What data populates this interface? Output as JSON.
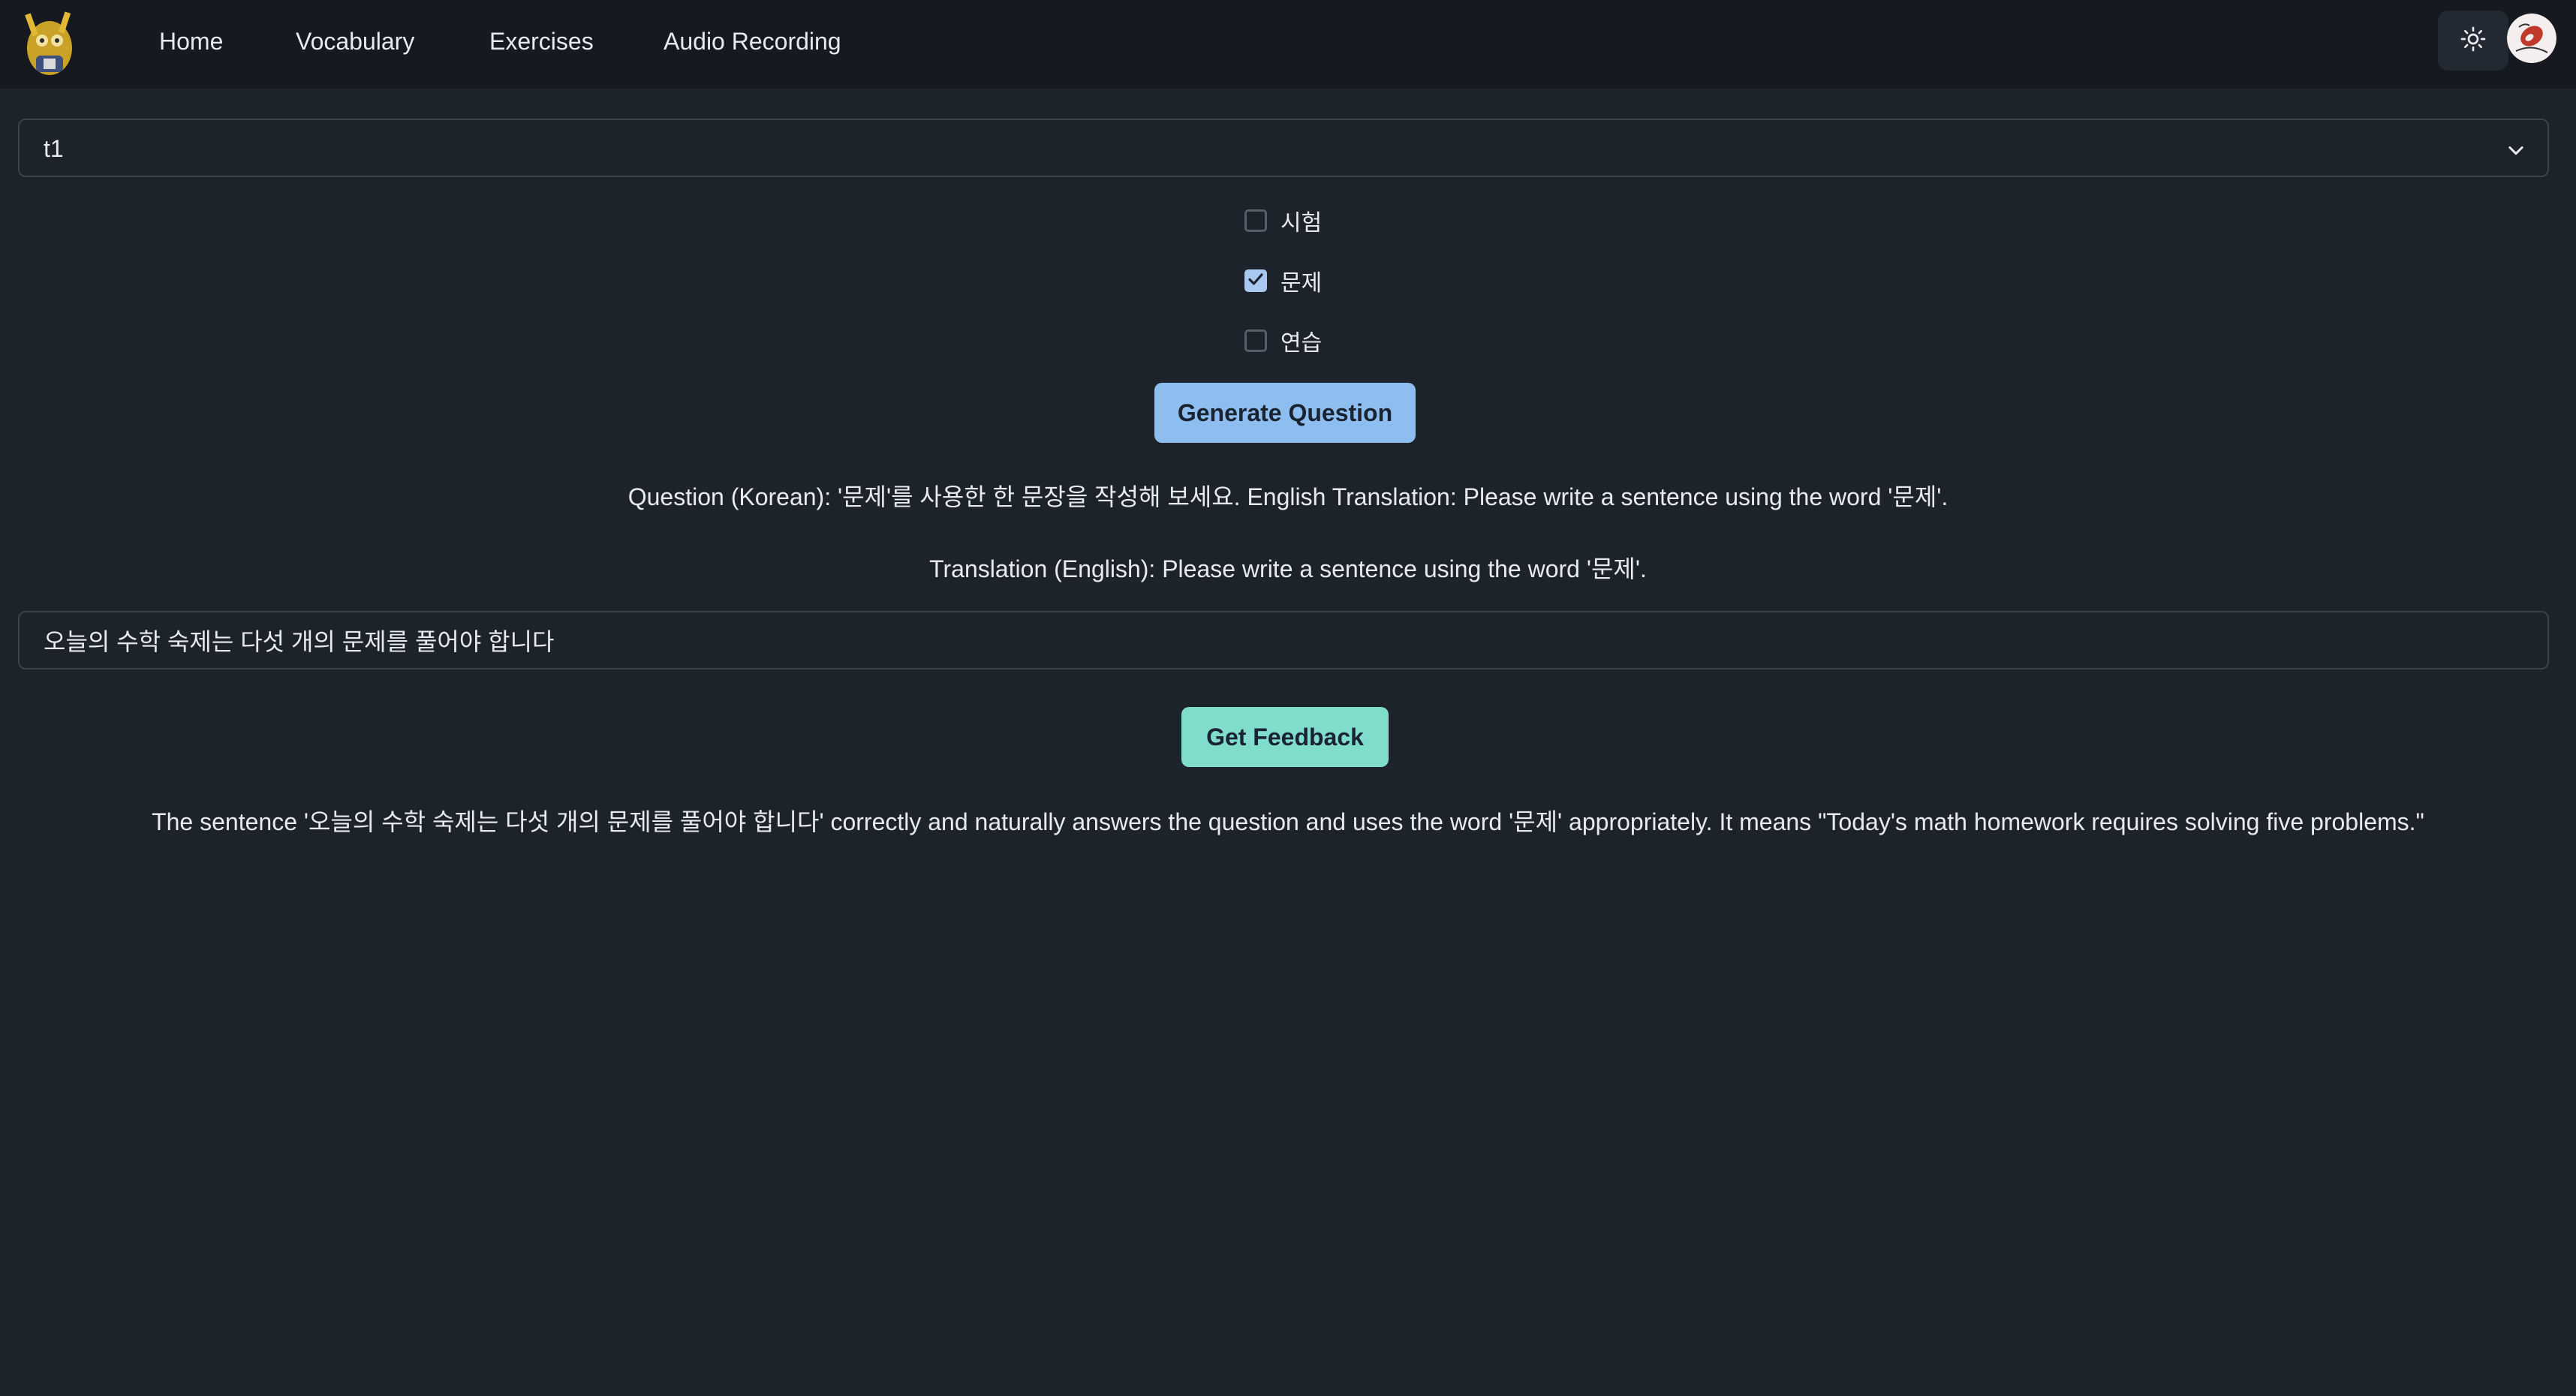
{
  "nav": {
    "links": [
      "Home",
      "Vocabulary",
      "Exercises",
      "Audio Recording"
    ],
    "theme_icon": "sun-icon",
    "avatar_icon": "avatar"
  },
  "deck_select": {
    "value": "t1"
  },
  "words": [
    {
      "label": "시험",
      "checked": false
    },
    {
      "label": "문제",
      "checked": true
    },
    {
      "label": "연습",
      "checked": false
    }
  ],
  "generate_button": "Generate Question",
  "question_text": "Question (Korean): '문제'를 사용한 한 문장을 작성해 보세요. English Translation: Please write a sentence using the word '문제'.",
  "translation_text": "Translation (English): Please write a sentence using the word '문제'.",
  "answer_input": {
    "value": "오늘의 수학 숙제는 다섯 개의 문제를 풀어야 합니다"
  },
  "feedback_button": "Get Feedback",
  "feedback_text": "The sentence '오늘의 수학 숙제는 다섯 개의 문제를 풀어야 합니다' correctly and naturally answers the question and uses the word '문제' appropriately. It means \"Today's math homework requires solving five problems.\"",
  "colors": {
    "background": "#1d232a",
    "navbar": "#161a20",
    "primary": "#8ebdf0",
    "accent": "#80dccb"
  }
}
